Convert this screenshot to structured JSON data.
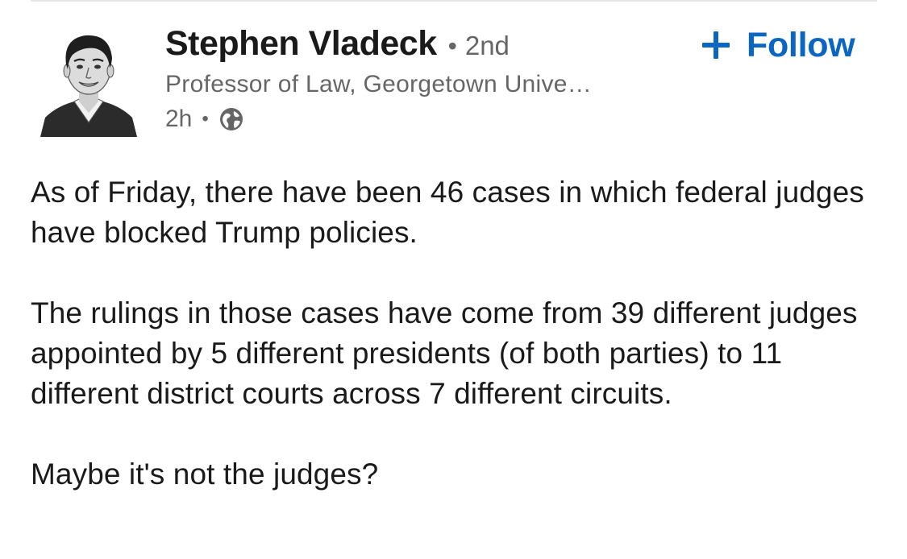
{
  "author": {
    "name": "Stephen Vladeck",
    "separator": "•",
    "degree": "2nd",
    "headline": "Professor of Law, Georgetown Unive…",
    "timestamp": "2h",
    "visibility_icon": "globe-icon",
    "avatar_icon": "avatar-illustration"
  },
  "follow": {
    "label": "Follow",
    "icon": "plus-icon",
    "color": "#0a66c2"
  },
  "post": {
    "paragraphs": [
      "As of Friday, there have been 46 cases in which federal judges have blocked Trump policies.",
      "The rulings in those cases have come from 39 different judges appointed by 5 different presidents (of both parties) to 11 different district courts across 7 different circuits.",
      "Maybe it's not the judges?"
    ]
  },
  "colors": {
    "primary_text": "#1a1a1a",
    "secondary_text": "#666666",
    "link_blue": "#0a66c2"
  }
}
